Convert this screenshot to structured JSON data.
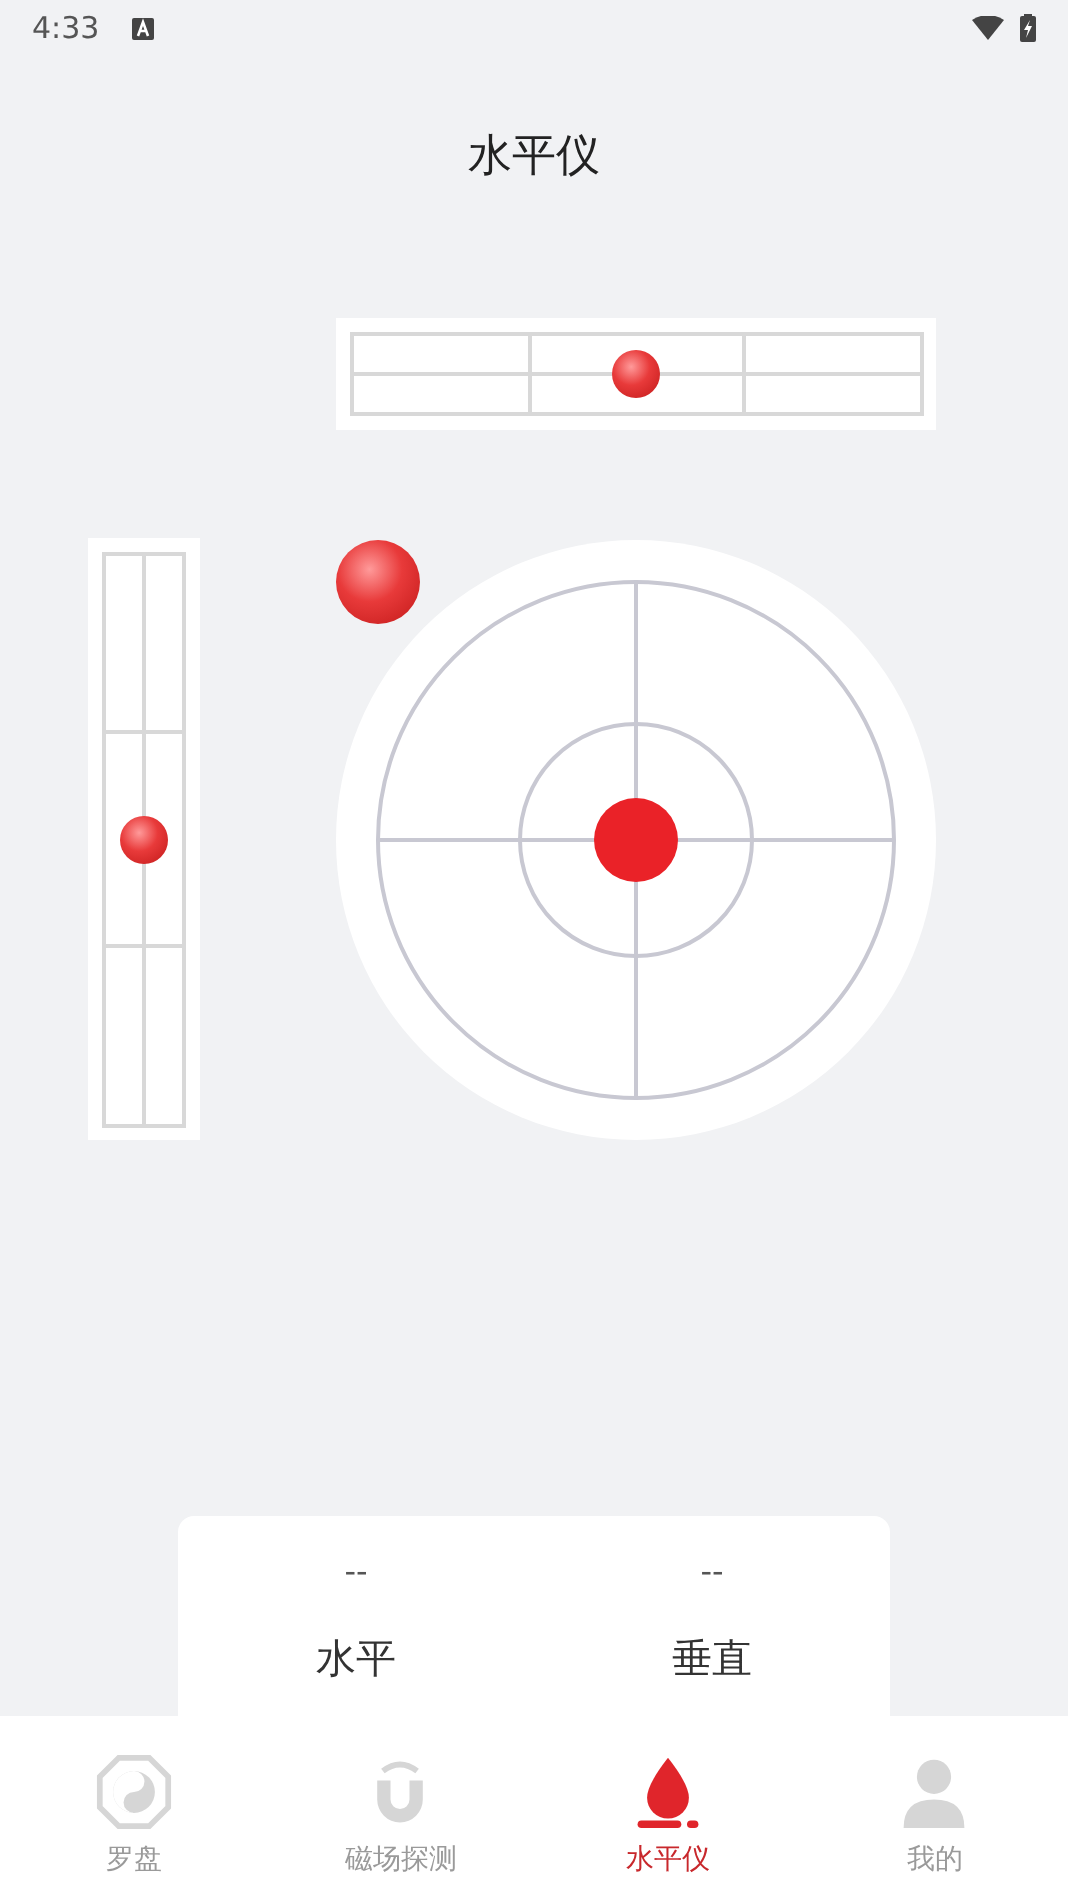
{
  "status_bar": {
    "time": "4:33"
  },
  "title": "水平仪",
  "readouts": [
    {
      "value": "--",
      "label": "水平"
    },
    {
      "value": "--",
      "label": "垂直"
    }
  ],
  "tabs": [
    {
      "kind": "compass",
      "label": "罗盘",
      "selected": false
    },
    {
      "kind": "magnet",
      "label": "磁场探测",
      "selected": false
    },
    {
      "kind": "level",
      "label": "水平仪",
      "selected": true
    },
    {
      "kind": "profile",
      "label": "我的",
      "selected": false
    }
  ]
}
